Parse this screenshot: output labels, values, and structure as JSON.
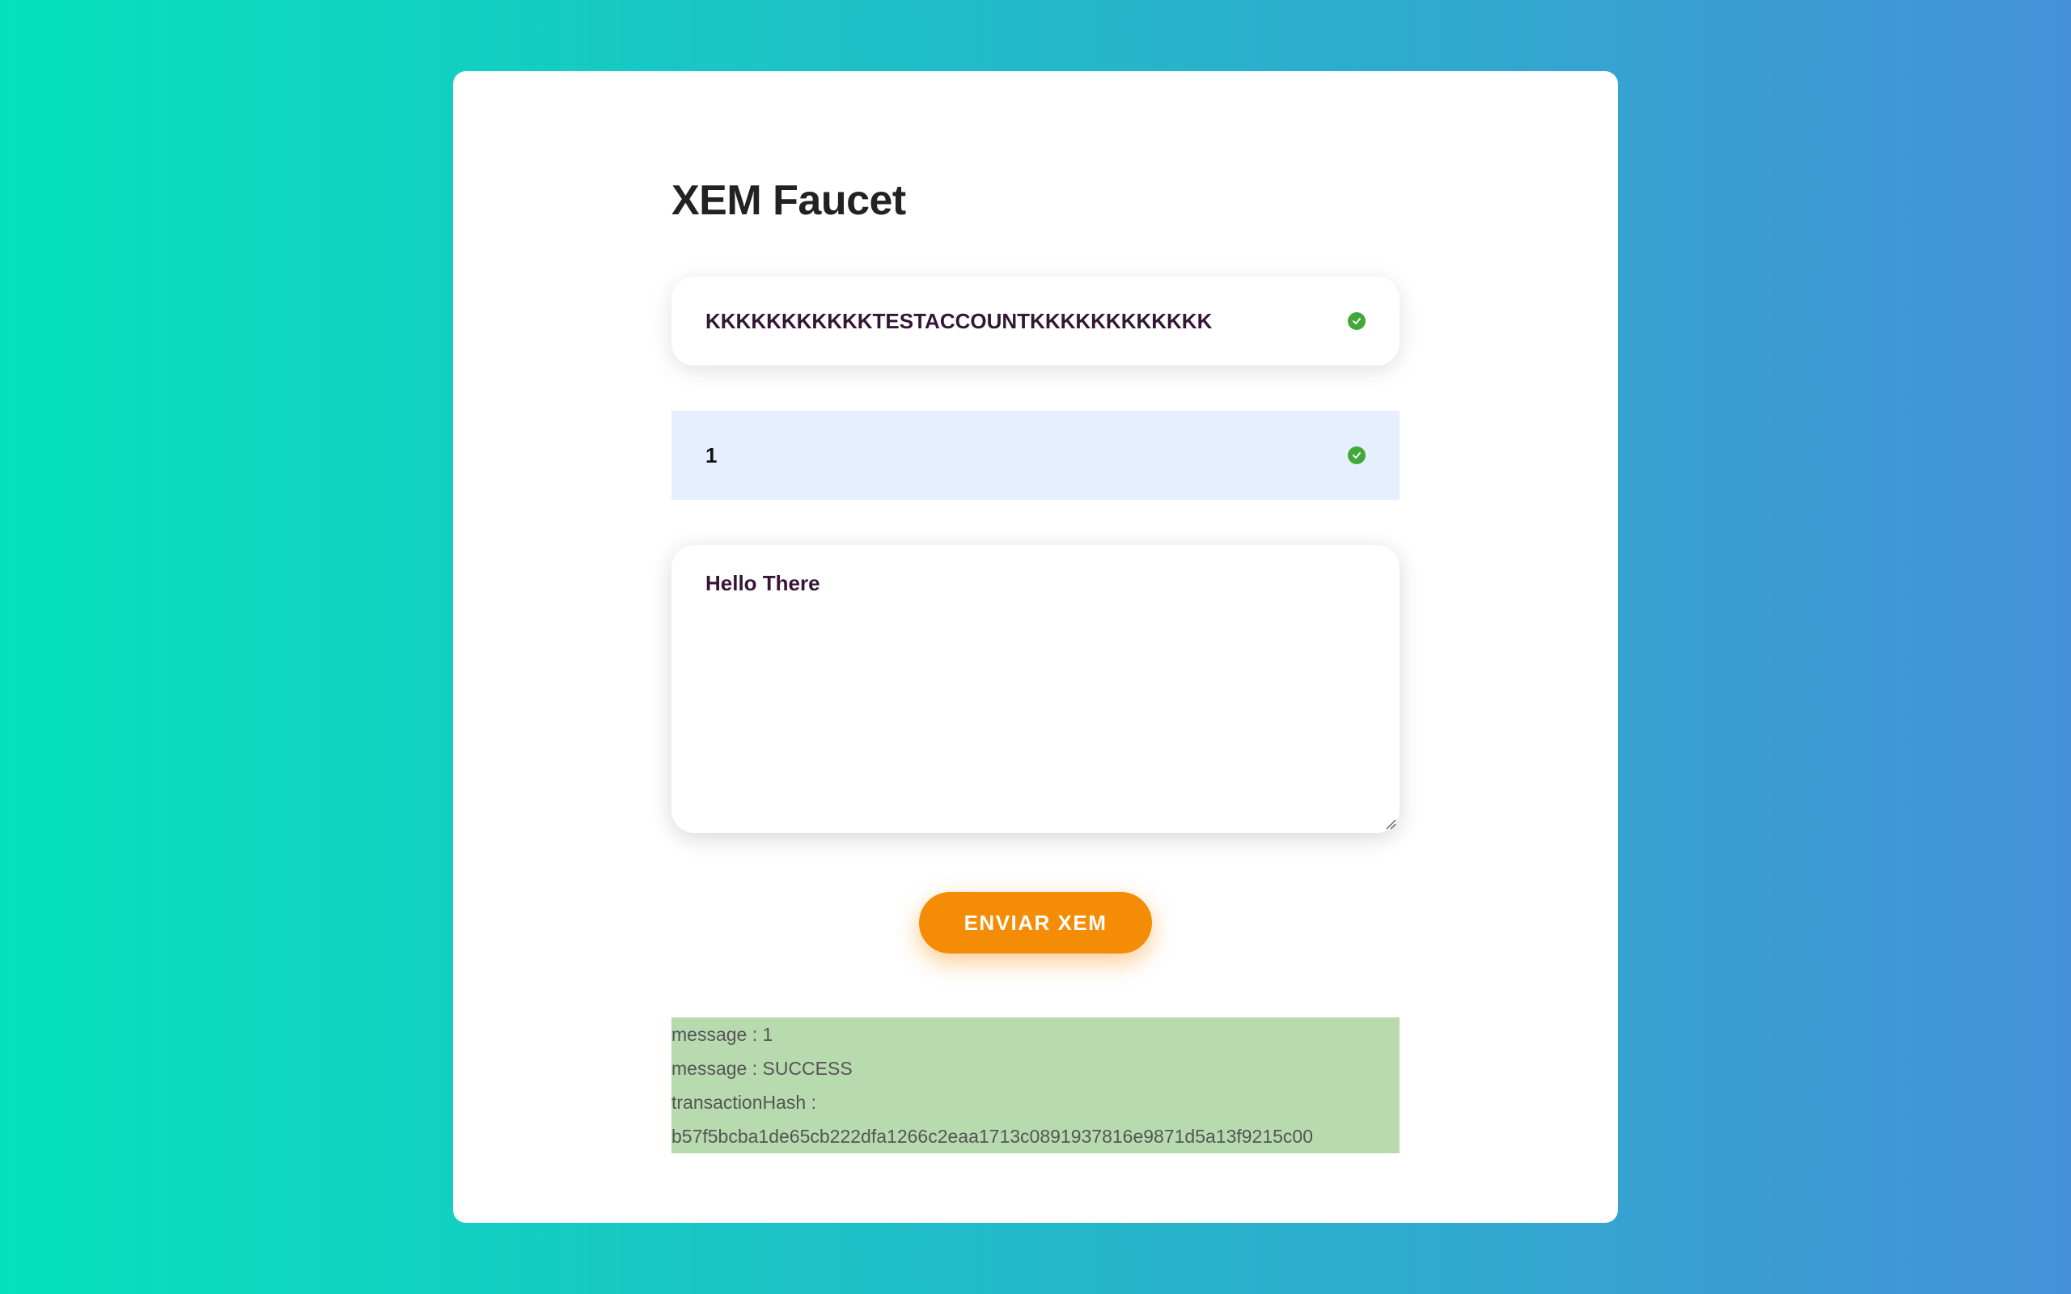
{
  "page": {
    "title": "XEM Faucet"
  },
  "form": {
    "address_value": "KKKKKKKKKKKTESTACCOUNTKKKKKKKKKKKK",
    "amount_value": "1",
    "message_value": "Hello There",
    "address_status_icon": "check-circle-icon",
    "amount_status_icon": "check-circle-icon",
    "submit_label": "ENVIAR XEM"
  },
  "response": {
    "lines": [
      "message : 1",
      "message : SUCCESS",
      "transactionHash :",
      "b57f5bcba1de65cb222dfa1266c2eaa1713c0891937816e9871d5a13f9215c00"
    ]
  },
  "colors": {
    "background_start": "#05e2bb",
    "background_end": "#4591d8",
    "button": "#f48c05",
    "success_check": "#43a83a",
    "response_bg": "#b8daaf",
    "amount_field_bg": "#e6effd"
  }
}
